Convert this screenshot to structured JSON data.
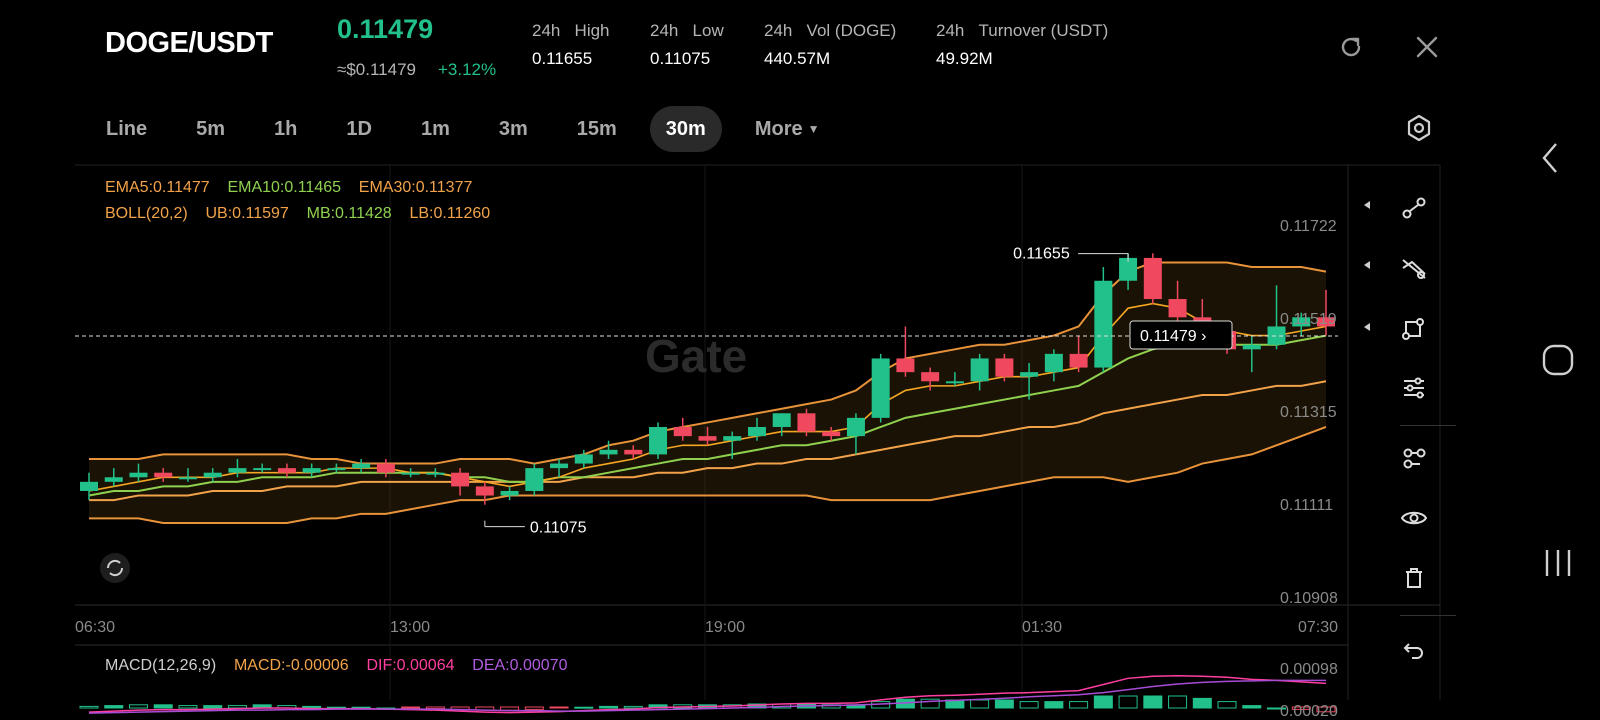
{
  "header": {
    "pair": "DOGE/USDT",
    "price": "0.11479",
    "usd_price": "≈$0.11479",
    "change": "+3.12%",
    "stats": [
      {
        "label_a": "24h",
        "label_b": "High",
        "value": "0.11655"
      },
      {
        "label_a": "24h",
        "label_b": "Low",
        "value": "0.11075"
      },
      {
        "label_a": "24h",
        "label_b": "Vol (DOGE)",
        "value": "440.57M"
      },
      {
        "label_a": "24h",
        "label_b": "Turnover (USDT)",
        "value": "49.92M"
      }
    ],
    "refresh_icon": "refresh-icon",
    "close_icon": "close-icon"
  },
  "timeframes": [
    "Line",
    "5m",
    "1h",
    "1D",
    "1m",
    "3m",
    "15m",
    "30m",
    "More"
  ],
  "active_timeframe": "30m",
  "indicators": {
    "ema5": "EMA5:0.11477",
    "ema10": "EMA10:0.11465",
    "ema30": "EMA30:0.11377",
    "boll": "BOLL(20,2)",
    "ub": "UB:0.11597",
    "mb": "MB:0.11428",
    "lb": "LB:0.11260"
  },
  "macd": {
    "label": "MACD(12,26,9)",
    "macd": "MACD:-0.00006",
    "dif": "DIF:0.00064",
    "dea": "DEA:0.00070",
    "axis_top": "0.00098",
    "axis_bottom": "0.00020"
  },
  "watermark": "Gate",
  "colors": {
    "up": "#22c08a",
    "down": "#f0485f",
    "ema5": "#f5a623",
    "ema10": "#8fd14f",
    "ema30": "#f2a34a",
    "boll": "#e8933a",
    "dif": "#ff3fa0",
    "dea": "#a84cd6"
  },
  "chart_data": {
    "type": "candlestick",
    "y_ticks": [
      "0.11722",
      "0.11519",
      "0.11315",
      "0.11111",
      "0.10908"
    ],
    "ylim": [
      0.10908,
      0.11722
    ],
    "x_ticks": [
      "06:30",
      "13:00",
      "19:00",
      "01:30",
      "07:30"
    ],
    "current_price_label": "0.11479",
    "high_label": "0.11655",
    "low_label": "0.11075",
    "candles": [
      {
        "o": 0.1114,
        "c": 0.1116,
        "h": 0.1118,
        "l": 0.1112
      },
      {
        "o": 0.1116,
        "c": 0.1117,
        "h": 0.1119,
        "l": 0.1115
      },
      {
        "o": 0.1117,
        "c": 0.1118,
        "h": 0.112,
        "l": 0.1116
      },
      {
        "o": 0.1118,
        "c": 0.1117,
        "h": 0.1119,
        "l": 0.1116
      },
      {
        "o": 0.1117,
        "c": 0.1117,
        "h": 0.1119,
        "l": 0.1116
      },
      {
        "o": 0.1117,
        "c": 0.1118,
        "h": 0.1119,
        "l": 0.1116
      },
      {
        "o": 0.1118,
        "c": 0.1119,
        "h": 0.1121,
        "l": 0.1117
      },
      {
        "o": 0.1119,
        "c": 0.1119,
        "h": 0.112,
        "l": 0.1118
      },
      {
        "o": 0.1119,
        "c": 0.1118,
        "h": 0.112,
        "l": 0.1117
      },
      {
        "o": 0.1118,
        "c": 0.1119,
        "h": 0.112,
        "l": 0.1117
      },
      {
        "o": 0.1119,
        "c": 0.1119,
        "h": 0.112,
        "l": 0.1118
      },
      {
        "o": 0.1119,
        "c": 0.112,
        "h": 0.1121,
        "l": 0.1118
      },
      {
        "o": 0.112,
        "c": 0.1118,
        "h": 0.1121,
        "l": 0.1117
      },
      {
        "o": 0.1118,
        "c": 0.1118,
        "h": 0.1119,
        "l": 0.1117
      },
      {
        "o": 0.1118,
        "c": 0.1118,
        "h": 0.1119,
        "l": 0.1117
      },
      {
        "o": 0.1118,
        "c": 0.1115,
        "h": 0.1119,
        "l": 0.1113
      },
      {
        "o": 0.1115,
        "c": 0.1113,
        "h": 0.1116,
        "l": 0.1111
      },
      {
        "o": 0.1113,
        "c": 0.1114,
        "h": 0.1115,
        "l": 0.1112
      },
      {
        "o": 0.1114,
        "c": 0.1119,
        "h": 0.112,
        "l": 0.1113
      },
      {
        "o": 0.1119,
        "c": 0.112,
        "h": 0.1121,
        "l": 0.1117
      },
      {
        "o": 0.112,
        "c": 0.1122,
        "h": 0.1123,
        "l": 0.1119
      },
      {
        "o": 0.1122,
        "c": 0.1123,
        "h": 0.1125,
        "l": 0.1121
      },
      {
        "o": 0.1123,
        "c": 0.1122,
        "h": 0.1124,
        "l": 0.1121
      },
      {
        "o": 0.1122,
        "c": 0.1128,
        "h": 0.1129,
        "l": 0.1121
      },
      {
        "o": 0.1128,
        "c": 0.1126,
        "h": 0.113,
        "l": 0.1125
      },
      {
        "o": 0.1126,
        "c": 0.1125,
        "h": 0.1128,
        "l": 0.1124
      },
      {
        "o": 0.1125,
        "c": 0.1126,
        "h": 0.1127,
        "l": 0.1121
      },
      {
        "o": 0.1126,
        "c": 0.1128,
        "h": 0.113,
        "l": 0.1125
      },
      {
        "o": 0.1128,
        "c": 0.1131,
        "h": 0.1131,
        "l": 0.1126
      },
      {
        "o": 0.1131,
        "c": 0.1127,
        "h": 0.1132,
        "l": 0.1126
      },
      {
        "o": 0.1127,
        "c": 0.1126,
        "h": 0.1128,
        "l": 0.1125
      },
      {
        "o": 0.1126,
        "c": 0.113,
        "h": 0.1131,
        "l": 0.1122
      },
      {
        "o": 0.113,
        "c": 0.1143,
        "h": 0.1144,
        "l": 0.1129
      },
      {
        "o": 0.1143,
        "c": 0.114,
        "h": 0.115,
        "l": 0.1139
      },
      {
        "o": 0.114,
        "c": 0.1138,
        "h": 0.1141,
        "l": 0.1136
      },
      {
        "o": 0.1138,
        "c": 0.1138,
        "h": 0.114,
        "l": 0.1137
      },
      {
        "o": 0.1138,
        "c": 0.1143,
        "h": 0.1144,
        "l": 0.1136
      },
      {
        "o": 0.1143,
        "c": 0.1139,
        "h": 0.1144,
        "l": 0.1138
      },
      {
        "o": 0.1139,
        "c": 0.114,
        "h": 0.1142,
        "l": 0.1134
      },
      {
        "o": 0.114,
        "c": 0.1144,
        "h": 0.1145,
        "l": 0.1138
      },
      {
        "o": 0.1144,
        "c": 0.1141,
        "h": 0.1148,
        "l": 0.114
      },
      {
        "o": 0.1141,
        "c": 0.116,
        "h": 0.1163,
        "l": 0.114
      },
      {
        "o": 0.116,
        "c": 0.1165,
        "h": 0.1166,
        "l": 0.1158
      },
      {
        "o": 0.1165,
        "c": 0.1156,
        "h": 0.1166,
        "l": 0.1155
      },
      {
        "o": 0.1156,
        "c": 0.1152,
        "h": 0.116,
        "l": 0.115
      },
      {
        "o": 0.1152,
        "c": 0.1149,
        "h": 0.1156,
        "l": 0.1145
      },
      {
        "o": 0.1149,
        "c": 0.1145,
        "h": 0.1151,
        "l": 0.1144
      },
      {
        "o": 0.1145,
        "c": 0.1146,
        "h": 0.1148,
        "l": 0.114
      },
      {
        "o": 0.1146,
        "c": 0.115,
        "h": 0.1159,
        "l": 0.1145
      },
      {
        "o": 0.115,
        "c": 0.1152,
        "h": 0.1153,
        "l": 0.1148
      },
      {
        "o": 0.1152,
        "c": 0.115,
        "h": 0.1158,
        "l": 0.1148
      }
    ],
    "ema5": [
      0.1114,
      0.1115,
      0.1116,
      0.1117,
      0.1117,
      0.1117,
      0.1118,
      0.1118,
      0.1118,
      0.1118,
      0.1119,
      0.1119,
      0.1119,
      0.1118,
      0.1118,
      0.1117,
      0.1116,
      0.1115,
      0.1116,
      0.1117,
      0.1119,
      0.112,
      0.1121,
      0.1123,
      0.1124,
      0.1124,
      0.1125,
      0.1126,
      0.1127,
      0.1127,
      0.1127,
      0.1128,
      0.1133,
      0.1136,
      0.1137,
      0.1137,
      0.1138,
      0.1139,
      0.1139,
      0.114,
      0.1141,
      0.1148,
      0.1154,
      0.1155,
      0.1154,
      0.1151,
      0.1149,
      0.1148,
      0.1148,
      0.1149,
      0.115
    ],
    "ema10": [
      0.1113,
      0.1114,
      0.1114,
      0.1115,
      0.1115,
      0.1116,
      0.1116,
      0.1117,
      0.1117,
      0.1117,
      0.1118,
      0.1118,
      0.1118,
      0.1118,
      0.1118,
      0.1117,
      0.1117,
      0.1116,
      0.1116,
      0.1117,
      0.1117,
      0.1118,
      0.1119,
      0.112,
      0.1121,
      0.1121,
      0.1122,
      0.1123,
      0.1124,
      0.1124,
      0.1125,
      0.1126,
      0.1128,
      0.113,
      0.1131,
      0.1132,
      0.1133,
      0.1134,
      0.1135,
      0.1136,
      0.1137,
      0.114,
      0.1143,
      0.1145,
      0.1146,
      0.1146,
      0.1146,
      0.1146,
      0.1146,
      0.1147,
      0.1148
    ],
    "ema30": [
      0.1112,
      0.1112,
      0.1113,
      0.1113,
      0.1113,
      0.1114,
      0.1114,
      0.1114,
      0.1115,
      0.1115,
      0.1115,
      0.1116,
      0.1116,
      0.1116,
      0.1116,
      0.1116,
      0.1116,
      0.1116,
      0.1116,
      0.1116,
      0.1117,
      0.1117,
      0.1117,
      0.1118,
      0.1118,
      0.1119,
      0.1119,
      0.112,
      0.112,
      0.1121,
      0.1121,
      0.1122,
      0.1123,
      0.1124,
      0.1125,
      0.1126,
      0.1126,
      0.1127,
      0.1128,
      0.1128,
      0.1129,
      0.1131,
      0.1132,
      0.1133,
      0.1134,
      0.1135,
      0.1135,
      0.1136,
      0.1137,
      0.1137,
      0.1138
    ],
    "boll_ub": [
      0.1121,
      0.1121,
      0.1121,
      0.1122,
      0.1122,
      0.1122,
      0.1122,
      0.1122,
      0.1122,
      0.1121,
      0.1121,
      0.112,
      0.112,
      0.112,
      0.112,
      0.1121,
      0.1121,
      0.1121,
      0.112,
      0.1121,
      0.1122,
      0.1124,
      0.1125,
      0.1127,
      0.1128,
      0.1129,
      0.113,
      0.1131,
      0.1132,
      0.1133,
      0.1134,
      0.1136,
      0.114,
      0.1143,
      0.1144,
      0.1145,
      0.1146,
      0.1146,
      0.1147,
      0.1148,
      0.115,
      0.1157,
      0.1162,
      0.1164,
      0.1164,
      0.1164,
      0.1164,
      0.1163,
      0.1163,
      0.1163,
      0.1162
    ],
    "boll_lb": [
      0.1108,
      0.1108,
      0.1108,
      0.1107,
      0.1107,
      0.1107,
      0.1107,
      0.1107,
      0.1107,
      0.1108,
      0.1108,
      0.1109,
      0.1109,
      0.111,
      0.1111,
      0.1112,
      0.1112,
      0.1113,
      0.1113,
      0.1113,
      0.1113,
      0.1113,
      0.1113,
      0.1113,
      0.1113,
      0.1113,
      0.1113,
      0.1113,
      0.1113,
      0.1113,
      0.1112,
      0.1112,
      0.1112,
      0.1112,
      0.1112,
      0.1113,
      0.1114,
      0.1115,
      0.1116,
      0.1117,
      0.1117,
      0.1117,
      0.1116,
      0.1117,
      0.1118,
      0.112,
      0.1121,
      0.1122,
      0.1124,
      0.1126,
      0.1128
    ],
    "macd_dif": [
      8e-05,
      0.0001,
      0.00012,
      0.00013,
      0.00013,
      0.00014,
      0.00015,
      0.00016,
      0.00016,
      0.00015,
      0.00015,
      0.00015,
      0.00014,
      0.00013,
      0.00012,
      0.0001,
      8e-05,
      7e-05,
      8e-05,
      9e-05,
      0.00011,
      0.00013,
      0.00014,
      0.00017,
      0.00018,
      0.00019,
      0.0002,
      0.00022,
      0.00024,
      0.00025,
      0.00025,
      0.00026,
      0.00032,
      0.00037,
      0.0004,
      0.00041,
      0.00043,
      0.00045,
      0.00046,
      0.00048,
      0.0005,
      0.00062,
      0.00074,
      0.00078,
      0.00079,
      0.00078,
      0.00076,
      0.00072,
      0.0007,
      0.00067,
      0.00064
    ],
    "macd_dea": [
      6e-05,
      7e-05,
      8e-05,
      9e-05,
      0.0001,
      0.00011,
      0.00012,
      0.00012,
      0.00013,
      0.00013,
      0.00014,
      0.00014,
      0.00014,
      0.00014,
      0.00014,
      0.00013,
      0.00012,
      0.00011,
      0.00011,
      0.0001,
      0.0001,
      0.00011,
      0.00012,
      0.00013,
      0.00014,
      0.00015,
      0.00016,
      0.00017,
      0.00019,
      0.0002,
      0.00021,
      0.00022,
      0.00024,
      0.00026,
      0.00029,
      0.00031,
      0.00033,
      0.00035,
      0.00038,
      0.0004,
      0.00042,
      0.00046,
      0.00052,
      0.00058,
      0.00063,
      0.00066,
      0.00068,
      0.00069,
      0.0007,
      0.0007,
      0.0007
    ]
  }
}
